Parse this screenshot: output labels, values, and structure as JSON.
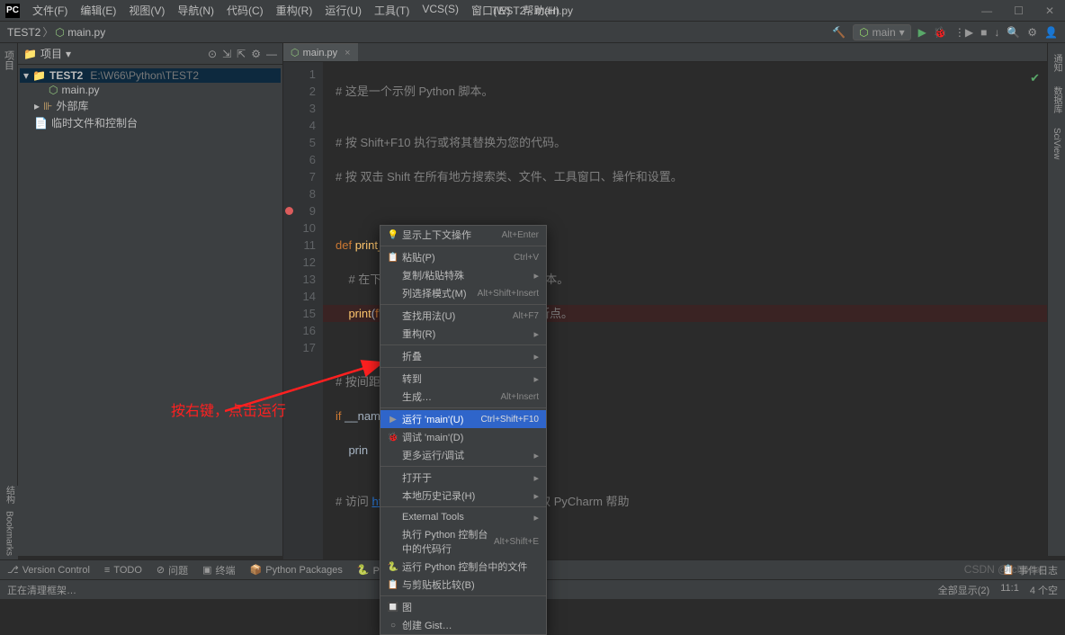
{
  "titlebar": {
    "app_title": "TEST2 - main.py",
    "menus": [
      "文件(F)",
      "编辑(E)",
      "视图(V)",
      "导航(N)",
      "代码(C)",
      "重构(R)",
      "运行(U)",
      "工具(T)",
      "VCS(S)",
      "窗口(W)",
      "帮助(H)"
    ]
  },
  "breadcrumb": {
    "root": "TEST2",
    "file": "main.py",
    "run_config": "main"
  },
  "sidebar": {
    "header": "项目",
    "items": [
      {
        "name": "TEST2",
        "path": "E:\\W66\\Python\\TEST2",
        "kind": "folder-root"
      },
      {
        "name": "main.py",
        "kind": "file-py"
      },
      {
        "name": "外部库",
        "kind": "lib"
      },
      {
        "name": "临时文件和控制台",
        "kind": "scratch"
      }
    ]
  },
  "tabs": {
    "active": "main.py"
  },
  "code": {
    "lines": [
      {
        "n": 1,
        "raw": "# 这是一个示例 Python 脚本。"
      },
      {
        "n": 2,
        "raw": ""
      },
      {
        "n": 3,
        "raw": "# 按 Shift+F10 执行或将其替换为您的代码。"
      },
      {
        "n": 4,
        "raw": "# 按 双击 Shift 在所有地方搜索类、文件、工具窗口、操作和设置。"
      },
      {
        "n": 5,
        "raw": ""
      },
      {
        "n": 6,
        "raw": ""
      },
      {
        "n": 7,
        "raw": "def print_hi(name):"
      },
      {
        "n": 8,
        "raw": "    # 在下面的代码行中使用断点来调试脚本。"
      },
      {
        "n": 9,
        "raw": "    print(f'Hi, {name}')  # 按 Ctrl+F8 切换断点。",
        "bp": true
      },
      {
        "n": 10,
        "raw": ""
      },
      {
        "n": 11,
        "raw": ""
      },
      {
        "n": 12,
        "raw": "# 按间距中的…"
      },
      {
        "n": 13,
        "raw": "if __name…"
      },
      {
        "n": 14,
        "raw": "    print…"
      },
      {
        "n": 15,
        "raw": ""
      },
      {
        "n": 16,
        "raw": "# 访问 https://www.jetbrains.com/help/pycharm/ 获取 PyCharm 帮助"
      },
      {
        "n": 17,
        "raw": ""
      }
    ]
  },
  "context_menu": [
    {
      "icon": "💡",
      "label": "显示上下文操作",
      "shortcut": "Alt+Enter"
    },
    {
      "sep": true
    },
    {
      "icon": "📋",
      "label": "粘贴(P)",
      "shortcut": "Ctrl+V"
    },
    {
      "label": "复制/粘贴特殊",
      "submenu": true
    },
    {
      "label": "列选择模式(M)",
      "shortcut": "Alt+Shift+Insert"
    },
    {
      "sep": true
    },
    {
      "label": "查找用法(U)",
      "shortcut": "Alt+F7"
    },
    {
      "label": "重构(R)",
      "submenu": true
    },
    {
      "sep": true
    },
    {
      "label": "折叠",
      "submenu": true
    },
    {
      "sep": true
    },
    {
      "label": "转到",
      "submenu": true
    },
    {
      "label": "生成…",
      "shortcut": "Alt+Insert"
    },
    {
      "sep": true
    },
    {
      "icon": "▶",
      "label": "运行 'main'(U)",
      "shortcut": "Ctrl+Shift+F10",
      "selected": true
    },
    {
      "icon": "🐞",
      "label": "调试 'main'(D)"
    },
    {
      "label": "更多运行/调试",
      "submenu": true
    },
    {
      "sep": true
    },
    {
      "label": "打开于",
      "submenu": true
    },
    {
      "label": "本地历史记录(H)",
      "submenu": true
    },
    {
      "sep": true
    },
    {
      "label": "External Tools",
      "submenu": true
    },
    {
      "label": "执行 Python 控制台中的代码行",
      "shortcut": "Alt+Shift+E"
    },
    {
      "icon": "🐍",
      "label": "运行 Python 控制台中的文件"
    },
    {
      "icon": "📋",
      "label": "与剪贴板比较(B)"
    },
    {
      "sep": true
    },
    {
      "icon": "🔲",
      "label": "图"
    },
    {
      "icon": "○",
      "label": "创建 Gist…"
    }
  ],
  "toolwindows": {
    "items": [
      "Version Control",
      "TODO",
      "问题",
      "终端",
      "Python Packages",
      "Python 控制台"
    ],
    "right": "事件日志"
  },
  "status": {
    "left": "正在清理框架…",
    "all_show": "全部显示(2)",
    "pos": "11:1",
    "spaces": "4 个空",
    "misc": ""
  },
  "left_tabs": {
    "top": "项目",
    "bottom": [
      "结构",
      "Bookmarks"
    ]
  },
  "right_tabs": [
    "通知",
    "数据库",
    "SciView"
  ],
  "annotation": "按右键，点击运行",
  "watermark": "CSDN @Ichocat"
}
